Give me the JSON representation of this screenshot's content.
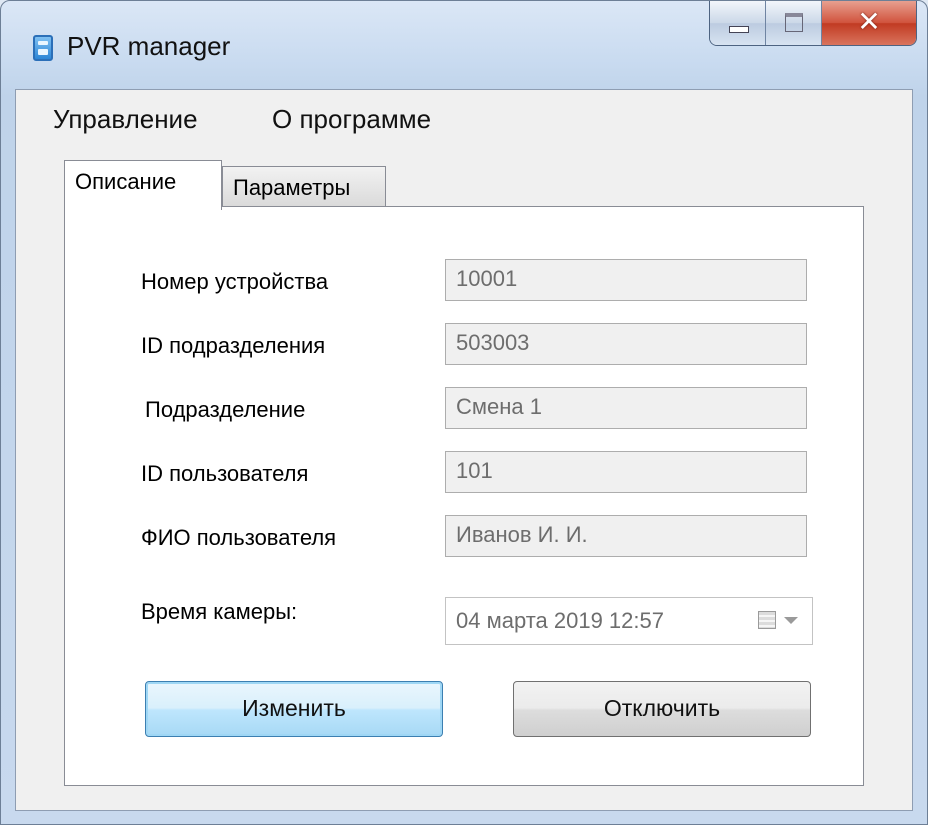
{
  "window": {
    "title": "PVR manager"
  },
  "menu": {
    "items": [
      "Управление",
      "О программе"
    ]
  },
  "tabs": [
    {
      "label": "Описание",
      "active": true
    },
    {
      "label": "Параметры",
      "active": false
    }
  ],
  "form": {
    "fields": [
      {
        "label": "Номер устройства",
        "value": "10001"
      },
      {
        "label": "ID подразделения",
        "value": "503003"
      },
      {
        "label": "Подразделение",
        "value": "Смена 1"
      },
      {
        "label": "ID пользователя",
        "value": "101"
      },
      {
        "label": "ФИО пользователя",
        "value": "Иванов И. И."
      }
    ],
    "camera_time": {
      "label": "Время камеры:",
      "value": "04  марта  2019 12:57"
    }
  },
  "buttons": {
    "change_label": "Изменить",
    "disconnect_label": "Отключить"
  },
  "icons": {
    "app": "pvr-app-icon",
    "minimize": "minimize-icon",
    "maximize": "maximize-icon",
    "close": "close-icon",
    "calendar": "calendar-icon",
    "dropdown": "chevron-down-icon"
  },
  "colors": {
    "close_button": "#c13a22",
    "primary_button_border": "#3c7fb1",
    "disabled_text": "#6d6d6d"
  }
}
